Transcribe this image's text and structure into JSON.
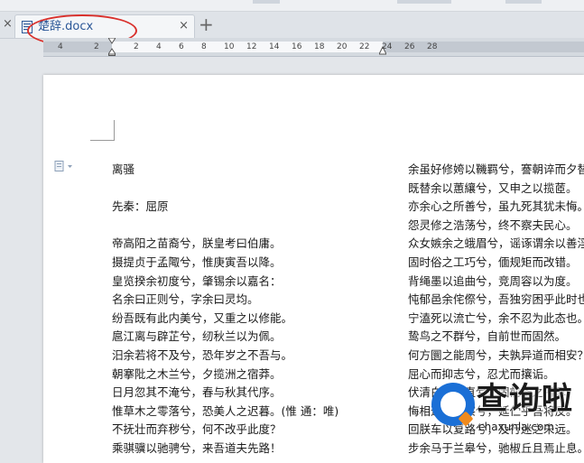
{
  "tab": {
    "title": "楚辞.docx",
    "close": "×"
  },
  "tabbar": {
    "left_close": "×",
    "new_tab": "+"
  },
  "ruler": {
    "labels": [
      "4",
      "2",
      "2",
      "4",
      "6",
      "8",
      "10",
      "12",
      "14",
      "16",
      "18",
      "20",
      "22",
      "24",
      "26",
      "28"
    ]
  },
  "document": {
    "left_column": [
      "离骚",
      "",
      "先秦：屈原",
      "",
      "帝高阳之苗裔兮，朕皇考曰伯庸。",
      "摄提贞于孟陬兮，惟庚寅吾以降。",
      "皇览揆余初度兮，肇锡余以嘉名：",
      "名余曰正则兮，字余曰灵均。",
      "纷吾既有此内美兮，又重之以修能。",
      "扈江离与辟芷兮，纫秋兰以为佩。",
      "汨余若将不及兮，恐年岁之不吾与。",
      "朝搴阰之木兰兮，夕揽洲之宿莽。",
      "日月忽其不淹兮，春与秋其代序。",
      "惟草木之零落兮，恐美人之迟暮。(惟 通：唯)",
      "不抚壮而弃秽兮，何不改乎此度？",
      "乘骐骥以驰骋兮，来吾道夫先路！"
    ],
    "right_column": [
      "余虽好修姱以鞿羁兮，謇朝谇而夕替。",
      "既替余以蕙纕兮，又申之以揽茝。",
      "亦余心之所善兮，虽九死其犹未悔。",
      "怨灵修之浩荡兮，终不察夫民心。",
      "众女嫉余之蛾眉兮，谣诼谓余以善淫。",
      "固时俗之工巧兮，偭规矩而改错。",
      "背绳墨以追曲兮，竞周容以为度。",
      "忳郁邑余侘傺兮，吾独穷困乎此时也。",
      "宁溘死以流亡兮，余不忍为此态也。",
      "鸷鸟之不群兮，自前世而固然。",
      "何方圜之能周兮，夫孰异道而相安？",
      "屈心而抑志兮，忍尤而攘诟。",
      "伏清白以死直兮，固前圣之所厚。",
      "悔相道之不察兮，延伫乎吾将反。",
      "回朕车以复路兮，及行迷之未远。",
      "步余马于兰皋兮，驰椒丘且焉止息。"
    ]
  },
  "watermark": {
    "brand": "查询啦",
    "domain": "chaxunla.com"
  },
  "colors": {
    "annotation_circle": "#d9302c",
    "tab_title": "#2b5797",
    "logo_blue": "#1a6fd6",
    "logo_orange": "#f08a1c"
  }
}
